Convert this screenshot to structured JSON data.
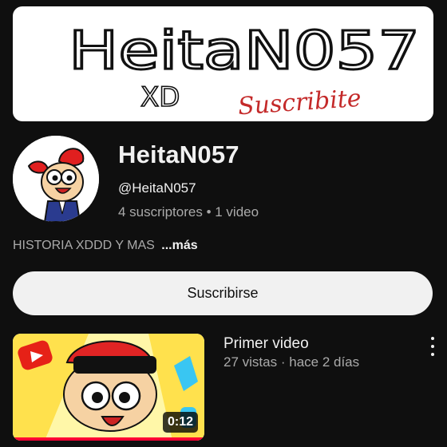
{
  "banner": {
    "text": "HeitaN057",
    "sub_left": "XD",
    "sub_right": "Suscribite"
  },
  "channel": {
    "name": "HeitaN057",
    "handle": "@HeitaN057",
    "subscribers": "4 suscriptores",
    "separator": "•",
    "video_count": "1 video",
    "description": "HISTORIA XDDD Y MAS",
    "more_label": "...más"
  },
  "subscribe_label": "Suscribirse",
  "videos": [
    {
      "title": "Primer video",
      "views": "27 vistas",
      "dot": "·",
      "age": "hace 2 días",
      "duration": "0:12"
    }
  ],
  "colors": {
    "background": "#0f0f0f",
    "primary_text": "#f1f1f1",
    "secondary_text": "#aaaaaa",
    "subscribe_bg": "#f1f1f1",
    "progress": "#ff0033"
  },
  "icons": {
    "more_options": "vertical-ellipsis-icon"
  }
}
